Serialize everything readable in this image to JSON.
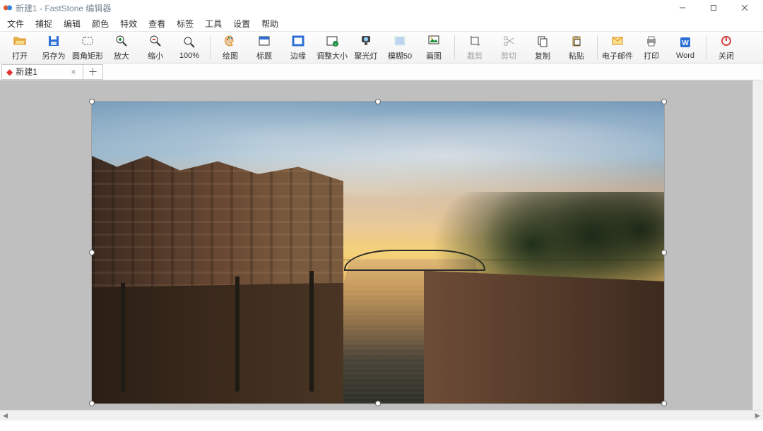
{
  "titlebar": {
    "title": "新建1 - FastStone 编辑器"
  },
  "menus": [
    "文件",
    "捕捉",
    "编辑",
    "颜色",
    "特效",
    "查看",
    "标签",
    "工具",
    "设置",
    "帮助"
  ],
  "toolbar": [
    {
      "name": "open",
      "label": "打开",
      "icon": "folder-open-icon"
    },
    {
      "name": "saveas",
      "label": "另存为",
      "icon": "save-icon"
    },
    {
      "name": "roundrect",
      "label": "圆角矩形",
      "icon": "rounded-rect-icon"
    },
    {
      "name": "zoomin",
      "label": "放大",
      "icon": "zoom-in-icon"
    },
    {
      "name": "zoomout",
      "label": "缩小",
      "icon": "zoom-out-icon"
    },
    {
      "name": "zoom100",
      "label": "100%",
      "icon": "zoom-actual-icon"
    },
    {
      "sep": true
    },
    {
      "name": "draw",
      "label": "绘图",
      "icon": "palette-icon"
    },
    {
      "name": "title",
      "label": "标题",
      "icon": "title-icon"
    },
    {
      "name": "edge",
      "label": "边缘",
      "icon": "edge-icon"
    },
    {
      "name": "resize",
      "label": "调整大小",
      "icon": "resize-arrows-icon"
    },
    {
      "name": "spot",
      "label": "聚光灯",
      "icon": "spotlight-icon"
    },
    {
      "name": "blur50",
      "label": "模糊50",
      "icon": "blur-icon"
    },
    {
      "name": "drawimg",
      "label": "画图",
      "icon": "canvas-icon"
    },
    {
      "sep": true
    },
    {
      "name": "crop",
      "label": "裁剪",
      "icon": "crop-icon",
      "disabled": true
    },
    {
      "name": "cut",
      "label": "剪切",
      "icon": "scissors-icon",
      "disabled": true
    },
    {
      "name": "copy",
      "label": "复制",
      "icon": "copy-icon"
    },
    {
      "name": "paste",
      "label": "粘贴",
      "icon": "paste-icon"
    },
    {
      "sep": true
    },
    {
      "name": "email",
      "label": "电子邮件",
      "icon": "mail-icon"
    },
    {
      "name": "print",
      "label": "打印",
      "icon": "printer-icon"
    },
    {
      "name": "word",
      "label": "Word",
      "icon": "word-icon"
    },
    {
      "sep": true
    },
    {
      "name": "close",
      "label": "关闭",
      "icon": "power-icon"
    }
  ],
  "tab": {
    "modified_marker": "◆",
    "name": "新建1",
    "close": "×",
    "add": "＋"
  }
}
